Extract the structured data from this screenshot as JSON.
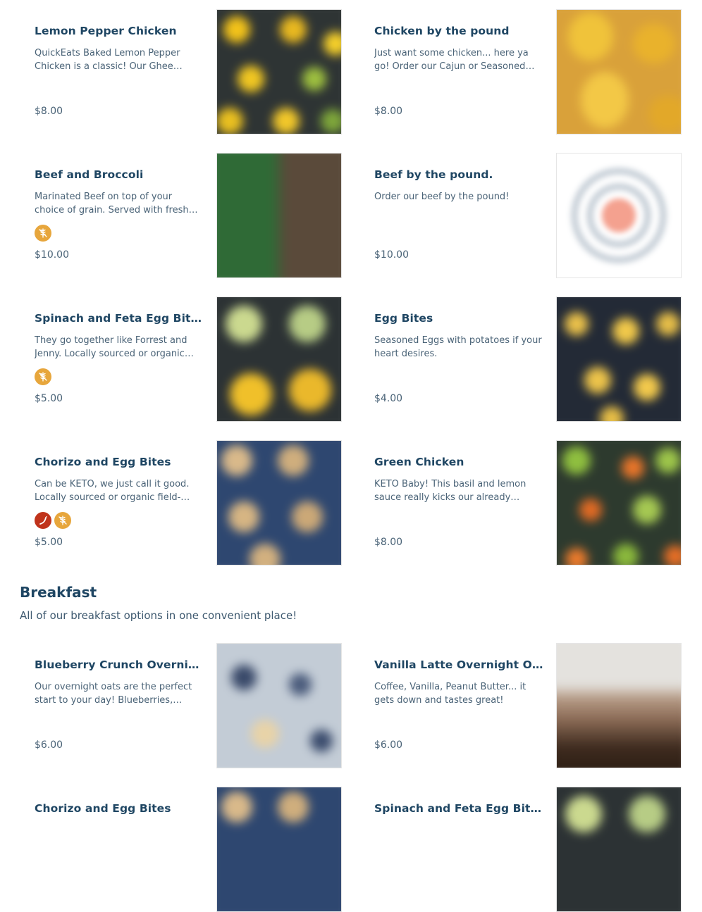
{
  "items": [
    {
      "title": "Lemon Pepper Chicken",
      "desc": "QuickEats Baked Lemon Pepper Chicken is a classic! Our Ghee Lemon Pepper chicken is baked to perfection.",
      "price": "$8.00",
      "badges": [],
      "image": "lemon-pepper-chicken-photo"
    },
    {
      "title": "Chicken by the pound",
      "desc": "Just want some chicken... here ya go! Order our Cajun or Seasoned chicken by the pound.",
      "price": "$8.00",
      "badges": [],
      "image": "chicken-by-pound-photo"
    },
    {
      "title": "Beef and Broccoli",
      "desc": "Marinated Beef on top of your choice of grain. Served with fresh broccoli! Yum.",
      "price": "$10.00",
      "badges": [
        "gluten-free-icon"
      ],
      "image": "beef-broccoli-photo"
    },
    {
      "title": "Beef by the pound.",
      "desc": "Order our beef by the pound!",
      "price": "$10.00",
      "badges": [],
      "image": "beef-by-pound-placeholder"
    },
    {
      "title": "Spinach and Feta Egg Bites",
      "desc": "They go together like Forrest and Jenny. Locally sourced or organic field-raised eggs.",
      "price": "$5.00",
      "badges": [
        "gluten-free-icon"
      ],
      "image": "spinach-feta-egg-bites-photo"
    },
    {
      "title": "Egg Bites",
      "desc": "Seasoned Eggs with potatoes if your heart desires.",
      "price": "$4.00",
      "badges": [],
      "image": "egg-bites-photo"
    },
    {
      "title": "Chorizo and Egg Bites",
      "desc": "Can be KETO, we just call it good. Locally sourced or organic field-raised eggs.",
      "price": "$5.00",
      "badges": [
        "spicy-icon",
        "gluten-free-icon"
      ],
      "image": "chorizo-egg-bites-photo"
    },
    {
      "title": "Green Chicken",
      "desc": "KETO Baby! This basil and lemon sauce really kicks our already delicious chicken up.",
      "price": "$8.00",
      "badges": [],
      "image": "green-chicken-photo"
    }
  ],
  "breakfast": {
    "title": "Breakfast",
    "description": "All of our breakfast options in one convenient place!",
    "items": [
      {
        "title": "Blueberry Crunch Overnight Oats",
        "desc": "Our overnight oats are the perfect start to your day! Blueberries, granola and more.",
        "price": "$6.00",
        "badges": [],
        "image": "blueberry-oats-photo"
      },
      {
        "title": "Vanilla Latte Overnight Oats",
        "desc": "Coffee, Vanilla, Peanut Butter... it gets down and tastes great!",
        "price": "$6.00",
        "badges": [],
        "image": "vanilla-latte-oats-photo"
      },
      {
        "title": "Chorizo and Egg Bites",
        "desc": "",
        "price": "",
        "badges": [],
        "image": "chorizo-egg-bites-photo"
      },
      {
        "title": "Spinach and Feta Egg Bites",
        "desc": "",
        "price": "",
        "badges": [],
        "image": "spinach-feta-egg-bites-photo"
      }
    ]
  },
  "colors": {
    "accent": "#1f4663",
    "gluten_badge": "#e7a63c",
    "spicy_badge": "#c0331b"
  }
}
